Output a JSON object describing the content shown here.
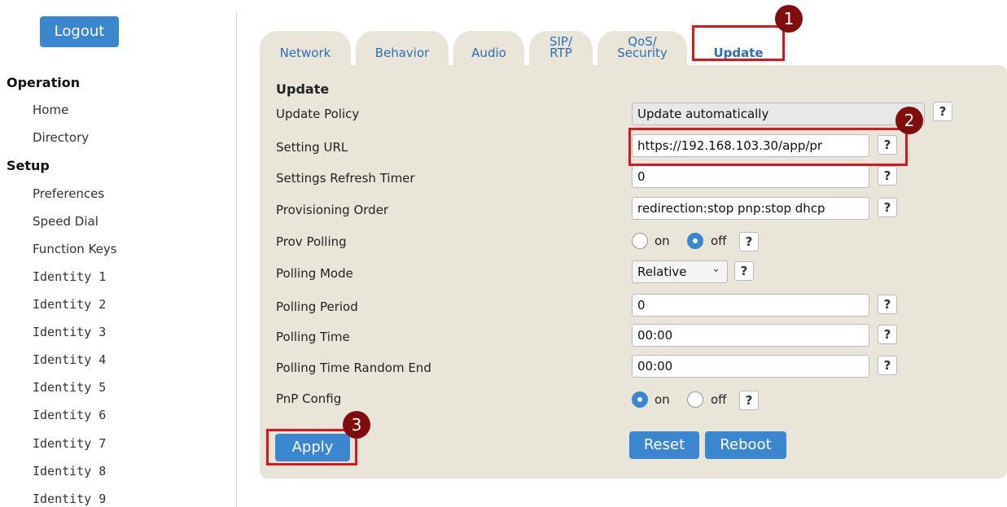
{
  "sidebar": {
    "logout_label": "Logout",
    "operation_heading": "Operation",
    "operation_items": [
      "Home",
      "Directory"
    ],
    "setup_heading": "Setup",
    "setup_items": [
      "Preferences",
      "Speed Dial",
      "Function Keys",
      "Identity 1",
      "Identity 2",
      "Identity 3",
      "Identity 4",
      "Identity 5",
      "Identity 6",
      "Identity 7",
      "Identity 8",
      "Identity 9"
    ]
  },
  "tabs": [
    {
      "line1": "Network",
      "line2": ""
    },
    {
      "line1": "Behavior",
      "line2": ""
    },
    {
      "line1": "Audio",
      "line2": ""
    },
    {
      "line1": "SIP/",
      "line2": "RTP"
    },
    {
      "line1": "QoS/",
      "line2": "Security"
    },
    {
      "line1": "Update",
      "line2": ""
    }
  ],
  "active_tab": "Update",
  "section_title": "Update",
  "fields": {
    "update_policy": {
      "label": "Update Policy",
      "value": "Update automatically"
    },
    "setting_url": {
      "label": "Setting URL",
      "value": "https://192.168.103.30/app/pr"
    },
    "settings_refresh_timer": {
      "label": "Settings Refresh Timer",
      "value": "0"
    },
    "provisioning_order": {
      "label": "Provisioning Order",
      "value": "redirection:stop pnp:stop dhcp"
    },
    "prov_polling": {
      "label": "Prov Polling",
      "on_label": "on",
      "off_label": "off",
      "selected": "off"
    },
    "polling_mode": {
      "label": "Polling Mode",
      "value": "Relative"
    },
    "polling_period": {
      "label": "Polling Period",
      "value": "0"
    },
    "polling_time": {
      "label": "Polling Time",
      "value": "00:00"
    },
    "polling_time_random_end": {
      "label": "Polling Time Random End",
      "value": "00:00"
    },
    "pnp_config": {
      "label": "PnP Config",
      "on_label": "on",
      "off_label": "off",
      "selected": "on"
    }
  },
  "help_glyph": "?",
  "chevron_glyph": "⌄",
  "buttons": {
    "apply": "Apply",
    "reset": "Reset",
    "reboot": "Reboot"
  },
  "markers": [
    "1",
    "2",
    "3"
  ],
  "colors": {
    "accent": "#3a87cf",
    "panel": "#e9e5d8",
    "highlight": "#e0141e",
    "marker": "#7f0d0d"
  }
}
